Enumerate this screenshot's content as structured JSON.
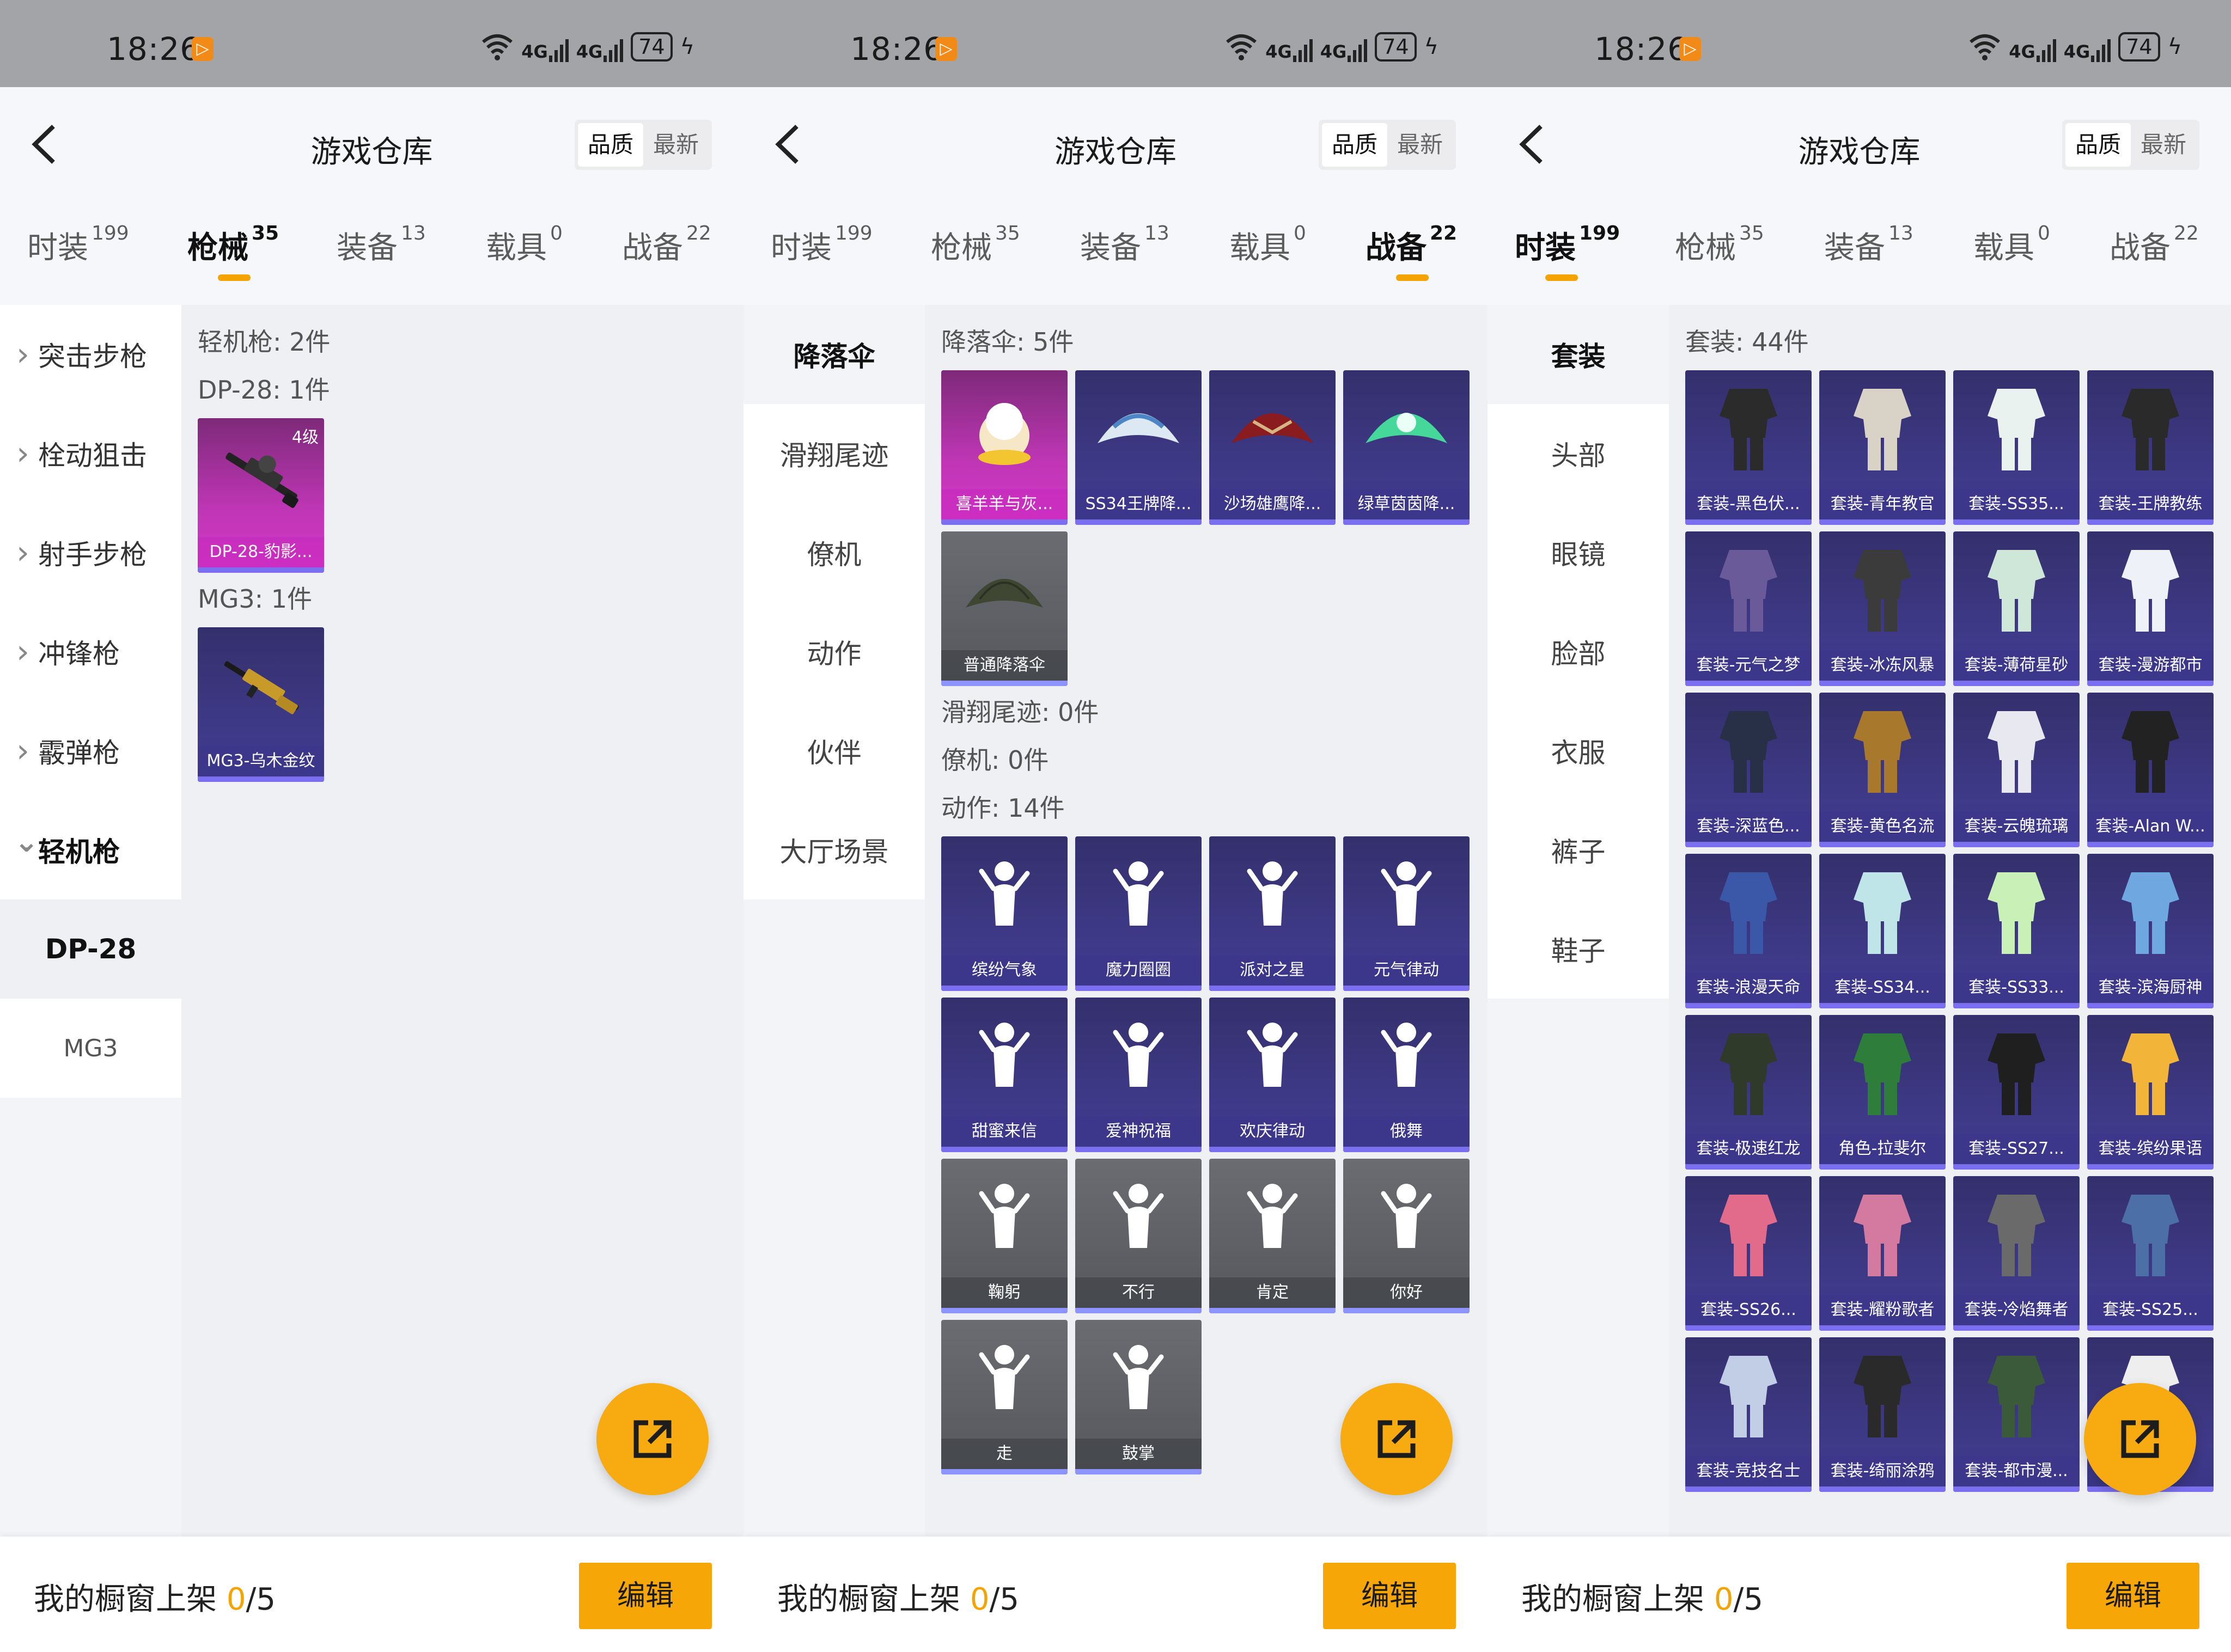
{
  "status": {
    "time": "18:26",
    "battery": "74",
    "net": "4G"
  },
  "header": {
    "title": "游戏仓库",
    "sort_quality": "品质",
    "sort_latest": "最新"
  },
  "tabs": [
    {
      "label": "时装",
      "count": "199"
    },
    {
      "label": "枪械",
      "count": "35"
    },
    {
      "label": "装备",
      "count": "13"
    },
    {
      "label": "载具",
      "count": "0"
    },
    {
      "label": "战备",
      "count": "22"
    }
  ],
  "bottom": {
    "label": "我的橱窗上架",
    "count": "0",
    "total": "/5",
    "edit": "编辑"
  },
  "panel1": {
    "sidebar": [
      "突击步枪",
      "栓动狙击",
      "射手步枪",
      "冲锋枪",
      "霰弹枪",
      "轻机枪",
      "DP-28",
      "MG3"
    ],
    "sec_main": "轻机枪: 2件",
    "sec_dp": "DP-28: 1件",
    "card_dp": {
      "name": "DP-28-豹影...",
      "level": "4级"
    },
    "sec_mg3": "MG3: 1件",
    "card_mg3": {
      "name": "MG3-乌木金纹"
    }
  },
  "panel2": {
    "sidebar": [
      "降落伞",
      "滑翔尾迹",
      "僚机",
      "动作",
      "伙伴",
      "大厅场景"
    ],
    "sec_para": "降落伞: 5件",
    "para": [
      "喜羊羊与灰...",
      "SS34王牌降...",
      "沙场雄鹰降...",
      "绿草茵茵降...",
      "普通降落伞"
    ],
    "sec_glide": "滑翔尾迹: 0件",
    "sec_wing": "僚机: 0件",
    "sec_act": "动作: 14件",
    "actions": [
      "缤纷气象",
      "魔力圈圈",
      "派对之星",
      "元气律动",
      "甜蜜来信",
      "爱神祝福",
      "欢庆律动",
      "俄舞",
      "鞠躬",
      "不行",
      "肯定",
      "你好",
      "走",
      "鼓掌"
    ]
  },
  "panel3": {
    "sidebar": [
      "套装",
      "头部",
      "眼镜",
      "脸部",
      "衣服",
      "裤子",
      "鞋子"
    ],
    "sec_set": "套装: 44件",
    "sets": [
      "套装-黑色伏...",
      "套装-青年教官",
      "套装-SS35...",
      "套装-王牌教练",
      "套装-元气之梦",
      "套装-冰冻风暴",
      "套装-薄荷星砂",
      "套装-漫游都市",
      "套装-深蓝色...",
      "套装-黄色名流",
      "套装-云魄琉璃",
      "套装-Alan W...",
      "套装-浪漫天命",
      "套装-SS34...",
      "套装-SS33...",
      "套装-滨海厨神",
      "套装-极速红龙",
      "角色-拉斐尔",
      "套装-SS27...",
      "套装-缤纷果语",
      "套装-SS26...",
      "套装-耀粉歌者",
      "套装-冷焰舞者",
      "套装-SS25...",
      "套装-竞技名士",
      "套装-绮丽涂鸦",
      "套装-都市漫...",
      ""
    ]
  }
}
